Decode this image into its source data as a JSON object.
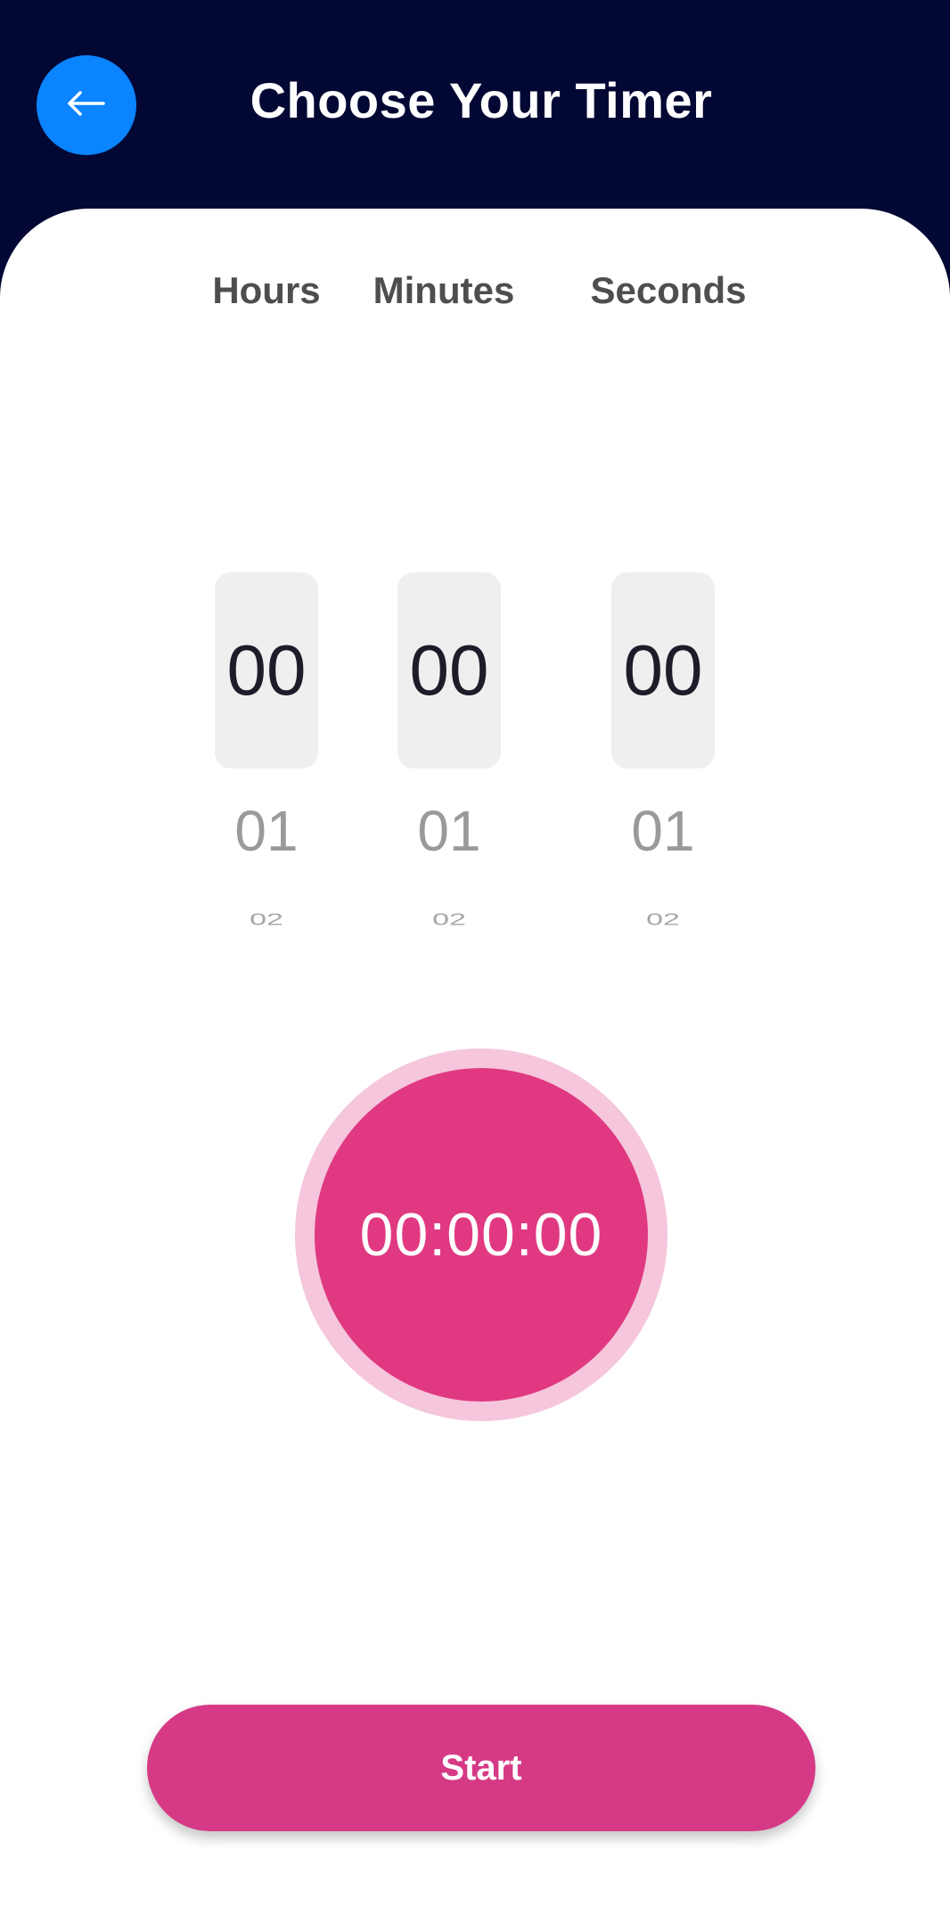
{
  "header": {
    "title": "Choose Your Timer",
    "back_icon": "arrow-left-icon"
  },
  "picker": {
    "columns": [
      {
        "label": "Hours",
        "selected": "00",
        "next": "01",
        "next2": "02"
      },
      {
        "label": "Minutes",
        "selected": "00",
        "next": "01",
        "next2": "02"
      },
      {
        "label": "Seconds",
        "selected": "00",
        "next": "01",
        "next2": "02"
      }
    ]
  },
  "timer": {
    "display": "00:00:00"
  },
  "actions": {
    "start_label": "Start"
  },
  "colors": {
    "header_bg": "#020733",
    "back_button": "#0a84ff",
    "dial": "#e03982",
    "dial_ring": "#f5c6dc",
    "start_button": "#d63a86"
  }
}
